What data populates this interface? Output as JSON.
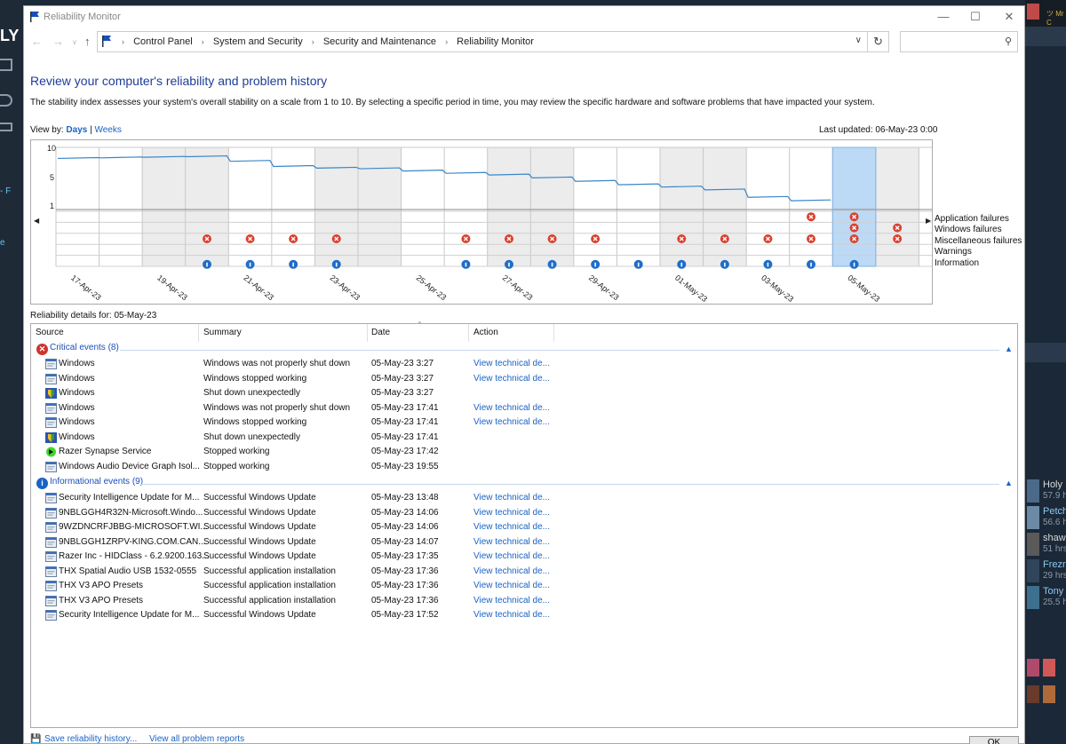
{
  "window": {
    "title": "Reliability Monitor"
  },
  "address": {
    "crumbs": [
      "Control Panel",
      "System and Security",
      "Security and Maintenance",
      "Reliability Monitor"
    ],
    "search_placeholder": ""
  },
  "page": {
    "heading": "Review your computer's reliability and problem history",
    "description": "The stability index assesses your system's overall stability on a scale from 1 to 10. By selecting a specific period in time, you may review the specific hardware and software problems that have impacted your system.",
    "view_by_label": "View by:",
    "days": "Days",
    "separator": "|",
    "weeks": "Weeks",
    "last_updated": "Last updated: 06-May-23 0:00",
    "details_for": "Reliability details for: 05-May-23"
  },
  "chart_data": {
    "type": "line",
    "y_ticks": [
      "10",
      "5",
      "1"
    ],
    "ylim": [
      1,
      10
    ],
    "date_labels": [
      "17-Apr-23",
      "19-Apr-23",
      "21-Apr-23",
      "23-Apr-23",
      "25-Apr-23",
      "27-Apr-23",
      "29-Apr-23",
      "01-May-23",
      "03-May-23",
      "05-May-23"
    ],
    "row_labels": [
      "Application failures",
      "Windows failures",
      "Miscellaneous failures",
      "Warnings",
      "Information"
    ],
    "selected_day": "05-May-23",
    "stability_index": [
      9.0,
      9.1,
      9.2,
      9.3,
      8.5,
      7.6,
      7.3,
      7.2,
      6.8,
      6.4,
      6.1,
      5.6,
      5.0,
      4.4,
      4.0,
      3.5,
      2.2,
      1.6
    ],
    "events": {
      "application_failures": [
        "04-May-23",
        "05-May-23"
      ],
      "windows_failures": [
        "05-May-23",
        "06-May-23"
      ],
      "miscellaneous_failures": [
        "20-Apr-23",
        "21-Apr-23",
        "22-Apr-23",
        "23-Apr-23",
        "26-Apr-23",
        "27-Apr-23",
        "28-Apr-23",
        "29-Apr-23",
        "01-May-23",
        "02-May-23",
        "03-May-23",
        "04-May-23",
        "05-May-23",
        "06-May-23"
      ],
      "information": [
        "20-Apr-23",
        "21-Apr-23",
        "22-Apr-23",
        "23-Apr-23",
        "26-Apr-23",
        "27-Apr-23",
        "28-Apr-23",
        "29-Apr-23",
        "30-Apr-23",
        "01-May-23",
        "02-May-23",
        "03-May-23",
        "04-May-23",
        "05-May-23"
      ]
    }
  },
  "table": {
    "headers": [
      "Source",
      "Summary",
      "Date",
      "Action"
    ],
    "critical_group": "Critical events (8)",
    "info_group": "Informational events (9)",
    "critical": [
      {
        "source": "Windows",
        "summary": "Windows was not properly shut down",
        "date": "05-May-23 3:27",
        "action": "View technical de...",
        "icon": "window-icon"
      },
      {
        "source": "Windows",
        "summary": "Windows stopped working",
        "date": "05-May-23 3:27",
        "action": "View technical de...",
        "icon": "window-icon"
      },
      {
        "source": "Windows",
        "summary": "Shut down unexpectedly",
        "date": "05-May-23 3:27",
        "action": "",
        "icon": "shield-icon"
      },
      {
        "source": "Windows",
        "summary": "Windows was not properly shut down",
        "date": "05-May-23 17:41",
        "action": "View technical de...",
        "icon": "window-icon"
      },
      {
        "source": "Windows",
        "summary": "Windows stopped working",
        "date": "05-May-23 17:41",
        "action": "View technical de...",
        "icon": "window-icon"
      },
      {
        "source": "Windows",
        "summary": "Shut down unexpectedly",
        "date": "05-May-23 17:41",
        "action": "",
        "icon": "shield-icon"
      },
      {
        "source": "Razer Synapse Service",
        "summary": "Stopped working",
        "date": "05-May-23 17:42",
        "action": "",
        "icon": "razer-icon"
      },
      {
        "source": "Windows Audio Device Graph Isol...",
        "summary": "Stopped working",
        "date": "05-May-23 19:55",
        "action": "",
        "icon": "window-icon"
      }
    ],
    "informational": [
      {
        "source": "Security Intelligence Update for M...",
        "summary": "Successful Windows Update",
        "date": "05-May-23 13:48",
        "action": "View technical de...",
        "icon": "window-icon"
      },
      {
        "source": "9NBLGGH4R32N-Microsoft.Windo...",
        "summary": "Successful Windows Update",
        "date": "05-May-23 14:06",
        "action": "View technical de...",
        "icon": "window-icon"
      },
      {
        "source": "9WZDNCRFJBBG-MICROSOFT.WI...",
        "summary": "Successful Windows Update",
        "date": "05-May-23 14:06",
        "action": "View technical de...",
        "icon": "window-icon"
      },
      {
        "source": "9NBLGGH1ZRPV-KING.COM.CAN...",
        "summary": "Successful Windows Update",
        "date": "05-May-23 14:07",
        "action": "View technical de...",
        "icon": "window-icon"
      },
      {
        "source": "Razer Inc - HIDClass - 6.2.9200.163...",
        "summary": "Successful Windows Update",
        "date": "05-May-23 17:35",
        "action": "View technical de...",
        "icon": "window-icon"
      },
      {
        "source": "THX Spatial Audio USB 1532-0555",
        "summary": "Successful application installation",
        "date": "05-May-23 17:36",
        "action": "View technical de...",
        "icon": "window-icon"
      },
      {
        "source": "THX V3 APO Presets",
        "summary": "Successful application installation",
        "date": "05-May-23 17:36",
        "action": "View technical de...",
        "icon": "window-icon"
      },
      {
        "source": "THX V3 APO Presets",
        "summary": "Successful application installation",
        "date": "05-May-23 17:36",
        "action": "View technical de...",
        "icon": "window-icon"
      },
      {
        "source": "Security Intelligence Update for M...",
        "summary": "Successful Windows Update",
        "date": "05-May-23 17:52",
        "action": "View technical de...",
        "icon": "window-icon"
      }
    ]
  },
  "footer": {
    "save": "Save reliability history...",
    "view_all": "View all problem reports",
    "ok": "OK"
  },
  "background": {
    "app_letters": "LY",
    "top_user": "ツ Mr C",
    "left_text_a": "- F",
    "left_text_b": "e",
    "friends": [
      {
        "name": "Holy",
        "hours": "57.9 h"
      },
      {
        "name": "Petch",
        "hours": "56.6 h"
      },
      {
        "name": "shaw",
        "hours": "51 hrs"
      },
      {
        "name": "Frezn",
        "hours": "29 hrs"
      },
      {
        "name": "Tony",
        "hours": "25.5 h"
      }
    ]
  }
}
